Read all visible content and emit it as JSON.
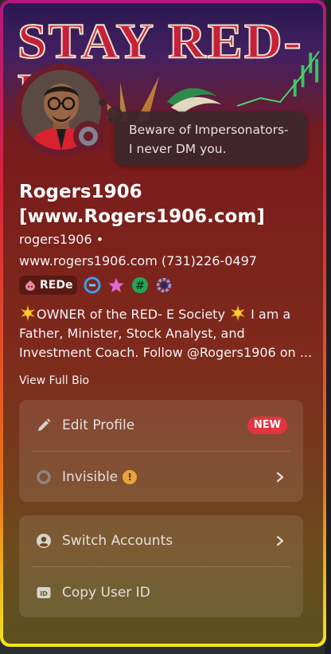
{
  "banner": {
    "title": "STAY RED-E"
  },
  "custom_status": "Beware of Impersonators- I never DM you.",
  "profile": {
    "display_name": "Rogers1906 [www.Rogers1906.com]",
    "username": "rogers1906",
    "separator": "•",
    "pronouns_line": "www.rogers1906.com (731)226-0497",
    "guild_tag": "REDe",
    "status": "Invisible"
  },
  "bio": {
    "text": "OWNER of the RED- E Society  I am a Father, Minister, Stock Analyst, and Investment Coach. Follow @Rogers1906 on ...",
    "part1": "OWNER of the RED- E Society",
    "part2": "I am a Father, Minister, Stock Analyst, and Investment Coach. Follow @Rogers1906 on ...",
    "view_full_label": "View Full Bio"
  },
  "menu": {
    "edit_profile": "Edit Profile",
    "new_badge": "NEW",
    "invisible": "Invisible",
    "switch_accounts": "Switch Accounts",
    "copy_user_id": "Copy User ID"
  },
  "colors": {
    "card_border_top": "#b3167e",
    "card_border_bottom": "#f4e51a",
    "new_badge": "#e3343f",
    "warning": "#e8a33a"
  },
  "icons": [
    "pencil-icon",
    "invisible-status-icon",
    "warning-icon",
    "account-icon",
    "id-icon",
    "chevron-right-icon"
  ]
}
